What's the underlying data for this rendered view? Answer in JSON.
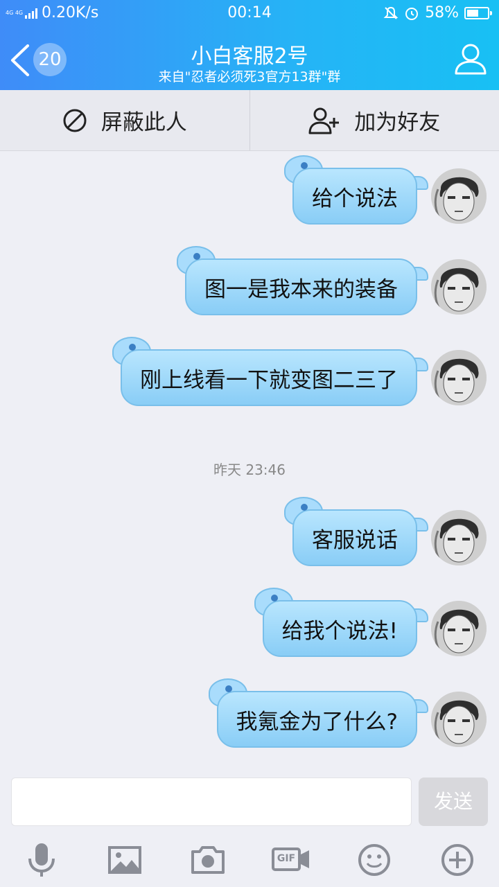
{
  "status_bar": {
    "network": "4G 4G",
    "speed": "0.20K/s",
    "time": "00:14",
    "battery": "58%",
    "battery_level": 0.58
  },
  "header": {
    "back_badge": "20",
    "title": "小白客服2号",
    "subtitle": "来自\"忍者必须死3官方13群\"群"
  },
  "actions": {
    "block_label": "屏蔽此人",
    "add_friend_label": "加为好友"
  },
  "messages": [
    {
      "text": "给个说法"
    },
    {
      "text": "图一是我本来的装备"
    },
    {
      "text": "刚上线看一下就变图二三了"
    },
    {
      "text": "客服说话"
    },
    {
      "text": "给我个说法!"
    },
    {
      "text": "我氪金为了什么?"
    }
  ],
  "timestamp": "昨天 23:46",
  "composer": {
    "placeholder": "",
    "send_label": "发送"
  },
  "toolbar": {
    "icons": [
      "microphone-icon",
      "image-icon",
      "camera-icon",
      "gif-icon",
      "emoji-icon",
      "plus-icon"
    ],
    "gif_text": "GIF"
  },
  "colors": {
    "header_start": "#3f8cf8",
    "header_end": "#18c0f4",
    "bubble": "#a9dcfc",
    "background": "#eeeff5"
  }
}
